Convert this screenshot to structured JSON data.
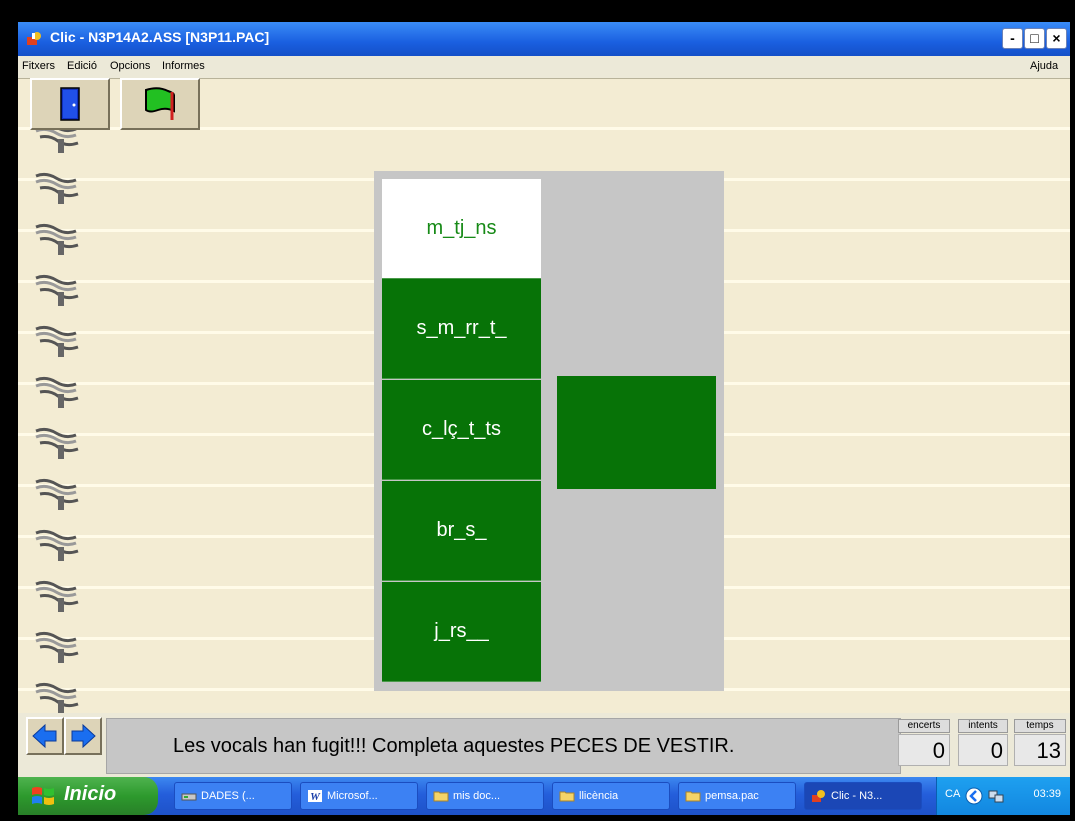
{
  "window": {
    "title": "Clic - N3P14A2.ASS [N3P11.PAC]",
    "controls": [
      "-",
      "□",
      "×"
    ]
  },
  "menu": {
    "items": [
      "Fitxers",
      "Edició",
      "Opcions",
      "Informes"
    ],
    "help": "Ajuda"
  },
  "toolbar": {
    "exit_icon": "door-icon",
    "flag_icon": "green-flag-icon"
  },
  "board": {
    "cells": [
      "m_tj_ns",
      "s_m_rr_t_",
      "c_lç_t_ts",
      "br_s_",
      "j_rs__"
    ],
    "selected_index": 0,
    "colors": {
      "green": "#077307",
      "selected_text": "#178a17",
      "board_bg": "#c6c6c6"
    }
  },
  "status": {
    "message": "Les vocals han fugit!!! Completa aquestes PECES DE VESTIR.",
    "counters": [
      {
        "label": "encerts",
        "value": "0"
      },
      {
        "label": "intents",
        "value": "0"
      },
      {
        "label": "temps",
        "value": "13"
      }
    ]
  },
  "taskbar": {
    "start_label": "Inicio",
    "tasks": [
      {
        "label": "DADES (...",
        "icon": "drive-icon"
      },
      {
        "label": "Microsof...",
        "icon": "word-icon"
      },
      {
        "label": "mis doc...",
        "icon": "folder-icon"
      },
      {
        "label": "llicència",
        "icon": "folder-icon"
      },
      {
        "label": "pemsa.pac",
        "icon": "folder-icon"
      },
      {
        "label": "Clic - N3...",
        "icon": "clic-icon"
      }
    ],
    "tray_lang": "CA",
    "clock": "03:39"
  }
}
